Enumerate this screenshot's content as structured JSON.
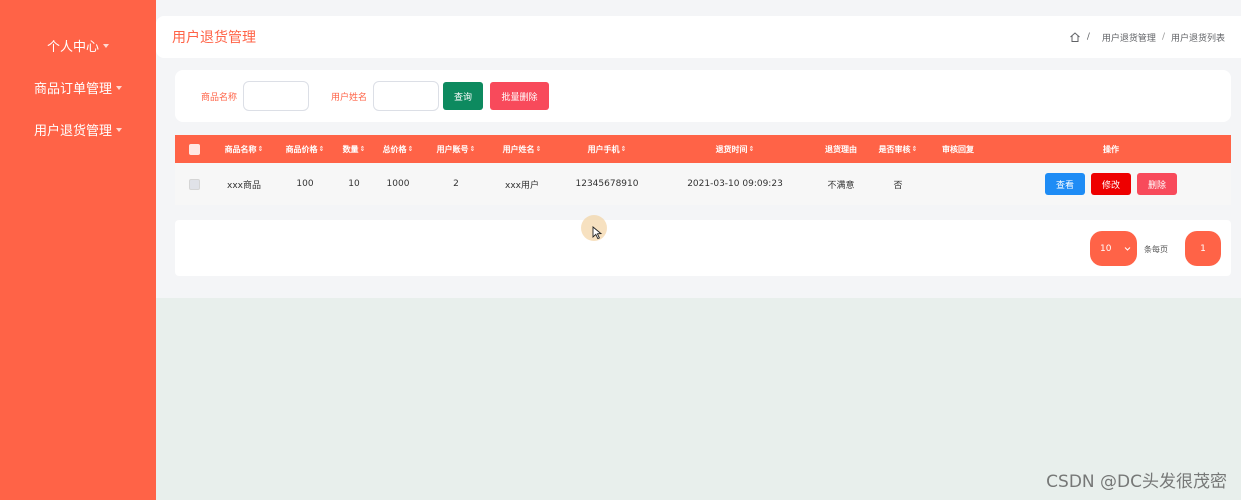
{
  "sidebar": {
    "items": [
      {
        "label": "个人中心"
      },
      {
        "label": "商品订单管理"
      },
      {
        "label": "用户退货管理"
      }
    ]
  },
  "header": {
    "title": "用户退货管理",
    "breadcrumb": [
      "用户退货管理",
      "用户退货列表"
    ],
    "breadcrumb_sep": "/"
  },
  "search": {
    "product_label": "商品名称",
    "username_label": "用户姓名",
    "product_value": "",
    "username_value": "",
    "query_label": "查询",
    "batch_delete_label": "批量删除"
  },
  "table": {
    "sort_glyph": "⇕",
    "columns": [
      "商品名称",
      "商品价格",
      "数量",
      "总价格",
      "用户账号",
      "用户姓名",
      "用户手机",
      "退货时间",
      "退货理由",
      "是否审核",
      "审核回复",
      "操作"
    ],
    "rows": [
      {
        "product": "xxx商品",
        "price": "100",
        "qty": "10",
        "total": "1000",
        "account": "2",
        "name": "xxx用户",
        "phone": "12345678910",
        "time": "2021-03-10 09:09:23",
        "reason": "不满意",
        "reviewed": "否",
        "reply": "",
        "view_label": "查看",
        "edit_label": "修改",
        "delete_label": "删除"
      }
    ]
  },
  "pagination": {
    "page_size": "10",
    "per_page_label": "条每页",
    "current_page": "1"
  },
  "watermark": "CSDN @DC头发很茂密",
  "colors": {
    "accent": "#ff6347",
    "query": "#0d8a5f",
    "danger": "#f84a5b",
    "view": "#1e8cf5",
    "edit": "#ee0000"
  }
}
